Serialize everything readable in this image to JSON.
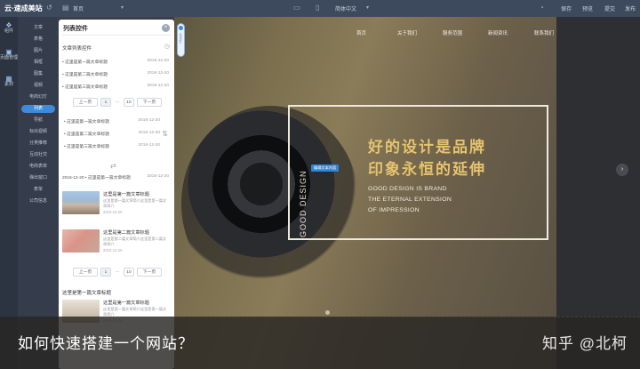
{
  "topbar": {
    "logo": "云·速成美站",
    "page_label": "首页",
    "language": "简体中文",
    "actions": [
      "保存",
      "预览",
      "提交",
      "发布"
    ]
  },
  "left_rail": [
    {
      "label": "组件",
      "icon": "components-icon"
    },
    {
      "label": "页面管理",
      "icon": "pages-icon"
    },
    {
      "label": "素材",
      "icon": "assets-icon"
    }
  ],
  "categories": [
    "文章",
    "表格",
    "图片",
    "相框",
    "图集",
    "视频",
    "电商幻灯",
    "列表",
    "导航",
    "标出视频",
    "分类推荐",
    "互动社交",
    "电商表单",
    "弹出窗口",
    "表单",
    "公司信息"
  ],
  "active_category": "列表",
  "panel": {
    "title": "列表控件",
    "section1": "文章列表控件",
    "rows_a": [
      {
        "title": "这里是第一篇文章标题",
        "date": "2016-12-20"
      },
      {
        "title": "这里是第二篇文章标题",
        "date": "2016-12-20"
      },
      {
        "title": "这里是第三篇文章标题",
        "date": "2016-12-20"
      }
    ],
    "pager": {
      "prev": "上一页",
      "page": "1",
      "dots": "…",
      "last": "10",
      "next": "下一页"
    },
    "rows_b": [
      {
        "title": "这里是第一篇文章标题",
        "date": "2016-12-20"
      },
      {
        "title": "这里是第二篇文章标题",
        "date": "2016-12-20"
      },
      {
        "title": "这里是第三篇文章标题",
        "date": "2016-12-20"
      }
    ],
    "inline_row": {
      "date": "2016-12-20",
      "title": "这里是第一篇文章标题",
      "date2": "2016-12-20"
    },
    "cards": [
      {
        "title": "这里是第一篇文章标题",
        "desc": "这里是第一篇文章简介这里是第一篇文章简介",
        "date": "2016-12-20"
      },
      {
        "title": "这里是第二篇文章标题",
        "desc": "这里是第二篇文章简介这里是第二篇文章简介",
        "date": "2016-12-20"
      }
    ],
    "section2": "这里是第一篇文章标题",
    "card3": {
      "title": "这里是第一篇文章标题",
      "desc": "这里是第一篇文章简介这里是第一篇文章简介",
      "date": "2016-12-20"
    }
  },
  "vertical_slider": {
    "label": "1000px"
  },
  "site": {
    "nav": [
      "首页",
      "关于我们",
      "服务范围",
      "新闻资讯",
      "联系我们"
    ],
    "vertical_text": "GOOD DESIGN",
    "headline1": "好的设计是品牌",
    "headline2": "印象永恒的延伸",
    "english": [
      "GOOD DESIGN IS BRAND",
      "THE ETERNAL EXTENSION",
      "OF IMPRESSION"
    ],
    "edit_tag": "编辑文本内容"
  },
  "caption": {
    "question": "如何快速搭建一个网站？",
    "watermark": "知乎 @北柯"
  },
  "colors": {
    "accent": "#3f8ad9",
    "gold": "#e6c36d"
  }
}
